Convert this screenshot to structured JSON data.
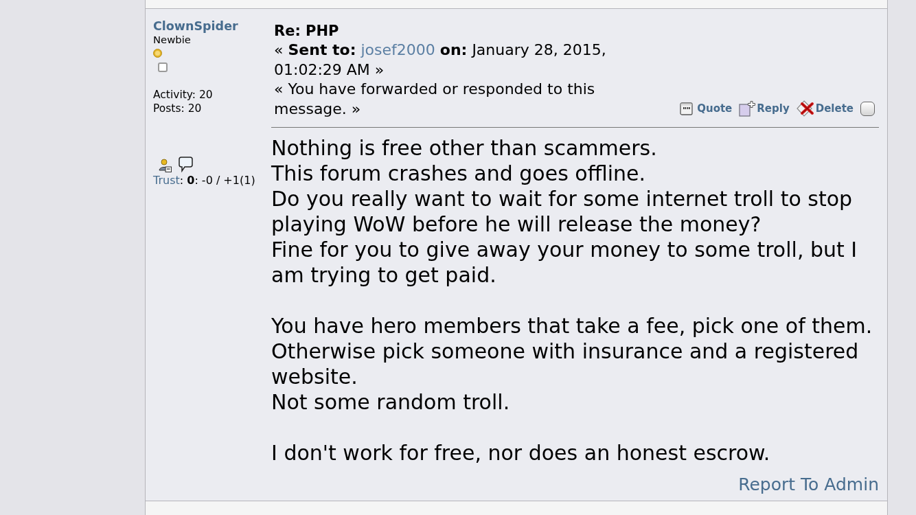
{
  "poster": {
    "name": "ClownSpider",
    "rank": "Newbie",
    "activity": "Activity: 20",
    "posts": "Posts: 20",
    "trust": {
      "label": "Trust",
      "rest": ": **0**: -0 / +1(1)"
    }
  },
  "message": {
    "subject": "Re: PHP",
    "sent_to": {
      "before": "« **Sent to:** ",
      "recipient": "josef2000",
      "after": " **on:** January 28, 2015, 01:02:29 AM »"
    },
    "notice": "« You have forwarded or responded to this message. »",
    "actions": [
      {
        "kind": "quote",
        "label": "Quote"
      },
      {
        "kind": "reply",
        "label": "Reply"
      },
      {
        "kind": "delete",
        "label": "Delete"
      }
    ],
    "select_checked": false,
    "paragraphs": [
      [
        "Nothing is free other than scammers.",
        "This forum crashes and goes offline.",
        "Do you really want to wait for some internet troll to stop playing WoW before he will release the money?",
        "Fine for you to give away your money to some troll, but I am trying to get paid."
      ],
      [
        "You have hero members that take a fee, pick one of them.",
        "Otherwise pick someone with insurance and a registered website.",
        "Not some random troll."
      ],
      [
        "I don't work for free, nor does an honest escrow."
      ]
    ],
    "report_link": "Report To Admin"
  }
}
